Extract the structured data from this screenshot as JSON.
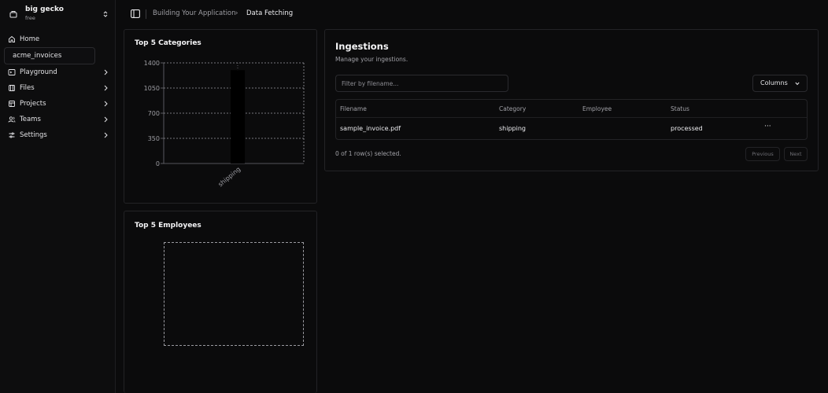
{
  "org": {
    "name": "big gecko",
    "plan": "free"
  },
  "nav": {
    "items": [
      {
        "label": "Home",
        "icon": "home-icon"
      },
      {
        "label": "acme_invoices",
        "active": true
      },
      {
        "label": "Playground",
        "icon": "terminal-icon"
      },
      {
        "label": "Files",
        "icon": "files-icon"
      },
      {
        "label": "Projects",
        "icon": "projects-icon"
      },
      {
        "label": "Teams",
        "icon": "users-icon"
      },
      {
        "label": "Settings",
        "icon": "settings-icon"
      }
    ]
  },
  "breadcrumb": {
    "parent": "Building Your Application",
    "separator": "›",
    "current": "Data Fetching"
  },
  "categories_card": {
    "title": "Top 5 Categories"
  },
  "employees_card": {
    "title": "Top 5 Employees"
  },
  "chart_data": {
    "type": "bar",
    "title": "Top 5 Categories",
    "categories": [
      "shipping"
    ],
    "values": [
      1300
    ],
    "ylim": [
      0,
      1400
    ],
    "yticks": [
      0,
      350,
      700,
      1050,
      1400
    ],
    "grid": true,
    "bar_color": "#000000"
  },
  "ingestions": {
    "title": "Ingestions",
    "subtitle": "Manage your ingestions.",
    "filter_placeholder": "Filter by filename...",
    "columns_label": "Columns",
    "headers": {
      "filename": "Filename",
      "category": "Category",
      "employee": "Employee",
      "status": "Status"
    },
    "rows": [
      {
        "filename": "sample_invoice.pdf",
        "category": "shipping",
        "employee": "",
        "status": "processed",
        "menu": "···"
      }
    ],
    "selection_text": "0 of 1 row(s) selected.",
    "previous_label": "Previous",
    "next_label": "Next"
  },
  "colors": {
    "background": "#0b0b0c",
    "border": "#232326",
    "text": "#ededf0",
    "muted": "#a1a1a7"
  }
}
